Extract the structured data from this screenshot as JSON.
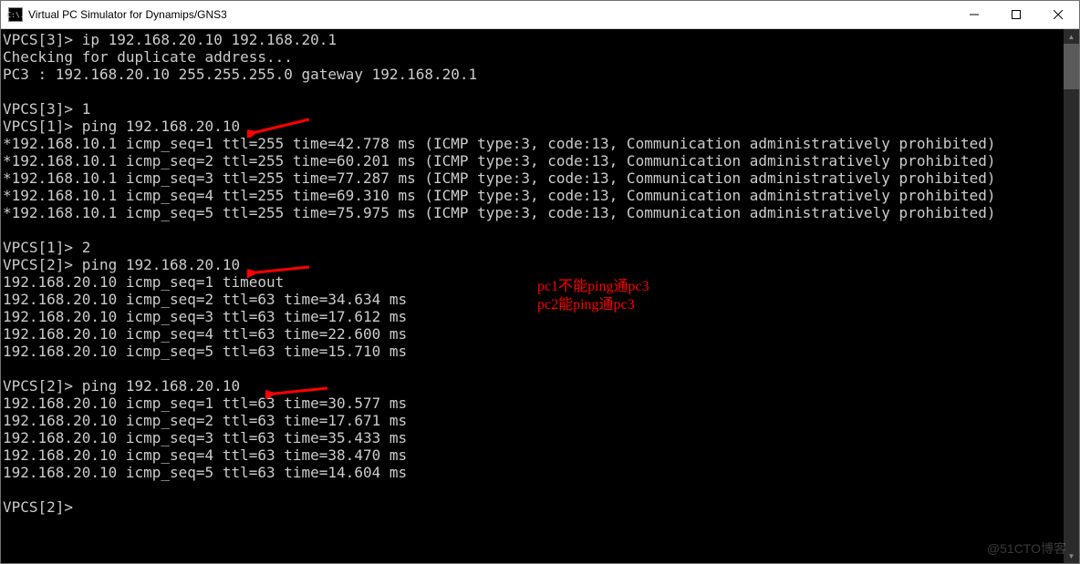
{
  "window": {
    "title": "Virtual PC Simulator for Dynamips/GNS3",
    "icon_label": "C:\\."
  },
  "terminal": {
    "lines": [
      "VPCS[3]> ip 192.168.20.10 192.168.20.1",
      "Checking for duplicate address...",
      "PC3 : 192.168.20.10 255.255.255.0 gateway 192.168.20.1",
      "",
      "VPCS[3]> 1",
      "VPCS[1]> ping 192.168.20.10",
      "*192.168.10.1 icmp_seq=1 ttl=255 time=42.778 ms (ICMP type:3, code:13, Communication administratively prohibited)",
      "*192.168.10.1 icmp_seq=2 ttl=255 time=60.201 ms (ICMP type:3, code:13, Communication administratively prohibited)",
      "*192.168.10.1 icmp_seq=3 ttl=255 time=77.287 ms (ICMP type:3, code:13, Communication administratively prohibited)",
      "*192.168.10.1 icmp_seq=4 ttl=255 time=69.310 ms (ICMP type:3, code:13, Communication administratively prohibited)",
      "*192.168.10.1 icmp_seq=5 ttl=255 time=75.975 ms (ICMP type:3, code:13, Communication administratively prohibited)",
      "",
      "VPCS[1]> 2",
      "VPCS[2]> ping 192.168.20.10",
      "192.168.20.10 icmp_seq=1 timeout",
      "192.168.20.10 icmp_seq=2 ttl=63 time=34.634 ms",
      "192.168.20.10 icmp_seq=3 ttl=63 time=17.612 ms",
      "192.168.20.10 icmp_seq=4 ttl=63 time=22.600 ms",
      "192.168.20.10 icmp_seq=5 ttl=63 time=15.710 ms",
      "",
      "VPCS[2]> ping 192.168.20.10",
      "192.168.20.10 icmp_seq=1 ttl=63 time=30.577 ms",
      "192.168.20.10 icmp_seq=2 ttl=63 time=17.671 ms",
      "192.168.20.10 icmp_seq=3 ttl=63 time=35.433 ms",
      "192.168.20.10 icmp_seq=4 ttl=63 time=38.470 ms",
      "192.168.20.10 icmp_seq=5 ttl=63 time=14.604 ms",
      "",
      "VPCS[2]>"
    ]
  },
  "annotations": {
    "note1": "pc1不能ping通pc3",
    "note2": "pc2能ping通pc3"
  },
  "watermark": "@51CTO博客"
}
